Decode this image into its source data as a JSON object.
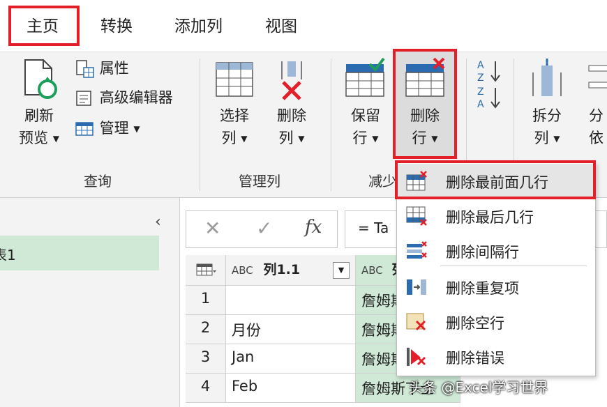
{
  "tabs": [
    {
      "label": "主页"
    },
    {
      "label": "转换"
    },
    {
      "label": "添加列"
    },
    {
      "label": "视图"
    }
  ],
  "ribbon": {
    "refresh": {
      "line1": "刷新",
      "line2": "预览"
    },
    "properties": "属性",
    "advanced_editor": "高级编辑器",
    "manage": "管理",
    "select_columns": {
      "line1": "选择",
      "line2": "列"
    },
    "remove_columns": {
      "line1": "删除",
      "line2": "列"
    },
    "keep_rows": {
      "line1": "保留",
      "line2": "行"
    },
    "remove_rows": {
      "line1": "删除",
      "line2": "行"
    },
    "split_column": {
      "line1": "拆分",
      "line2": "列"
    },
    "group_by": {
      "line1": "分",
      "line2": "依"
    },
    "groups": {
      "query": "查询",
      "manage_columns": "管理列",
      "reduce_rows": "减少"
    }
  },
  "formula_bar": {
    "formula": "= Ta"
  },
  "query_list": {
    "item": "表1"
  },
  "grid": {
    "column1_header": "列1.1",
    "column2_header": "列",
    "type_label": "ABC",
    "rows": [
      {
        "num": "1",
        "col1": "",
        "col2": "詹姆斯"
      },
      {
        "num": "2",
        "col1": "月份",
        "col2": "詹姆斯"
      },
      {
        "num": "3",
        "col1": "Jan",
        "col2": "詹姆斯"
      },
      {
        "num": "4",
        "col1": "Feb",
        "col2": "詹姆斯下士"
      }
    ]
  },
  "menu": {
    "items": [
      {
        "label": "删除最前面几行",
        "icon": "remove-top-rows-icon"
      },
      {
        "label": "删除最后几行",
        "icon": "remove-bottom-rows-icon"
      },
      {
        "label": "删除间隔行",
        "icon": "remove-alternate-rows-icon"
      },
      {
        "label": "删除重复项",
        "icon": "remove-duplicates-icon"
      },
      {
        "label": "删除空行",
        "icon": "remove-blank-rows-icon"
      },
      {
        "label": "删除错误",
        "icon": "remove-errors-icon"
      }
    ]
  },
  "watermark": "头条 @Excel学习世界",
  "colors": {
    "highlight": "#e3202a",
    "accent_green": "#1e9e5a",
    "accent_blue": "#2b6cb0",
    "selected_green": "#cfe9d6"
  }
}
